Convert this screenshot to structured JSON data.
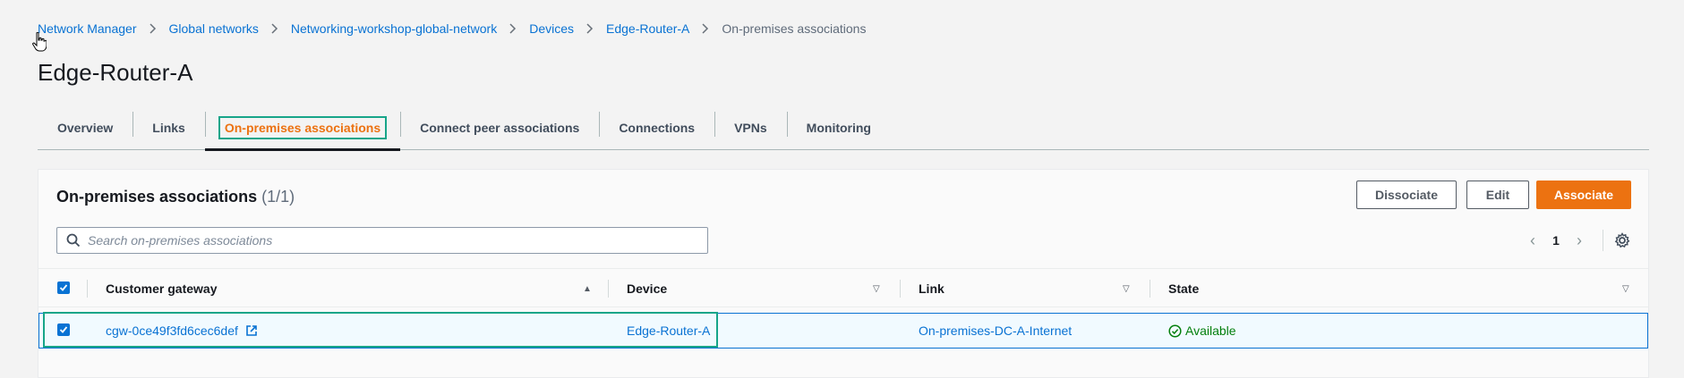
{
  "breadcrumb": {
    "items": [
      "Network Manager",
      "Global networks",
      "Networking-workshop-global-network",
      "Devices",
      "Edge-Router-A"
    ],
    "current": "On-premises associations"
  },
  "page": {
    "title": "Edge-Router-A"
  },
  "tabs": [
    {
      "label": "Overview"
    },
    {
      "label": "Links"
    },
    {
      "label": "On-premises associations",
      "active": true
    },
    {
      "label": "Connect peer associations"
    },
    {
      "label": "Connections"
    },
    {
      "label": "VPNs"
    },
    {
      "label": "Monitoring"
    }
  ],
  "panel": {
    "title": "On-premises associations",
    "count": "(1/1)",
    "buttons": {
      "dissociate": "Dissociate",
      "edit": "Edit",
      "associate": "Associate"
    },
    "search_placeholder": "Search on-premises associations",
    "page_number": "1"
  },
  "table": {
    "columns": [
      "Customer gateway",
      "Device",
      "Link",
      "State"
    ],
    "rows": [
      {
        "customer_gateway": "cgw-0ce49f3fd6cec6def",
        "device": "Edge-Router-A",
        "link": "On-premises-DC-A-Internet",
        "state": "Available",
        "selected": true
      }
    ]
  },
  "colors": {
    "accent": "#ec7211",
    "link": "#0972d3",
    "success": "#037f0c",
    "highlight": "#17a589"
  }
}
